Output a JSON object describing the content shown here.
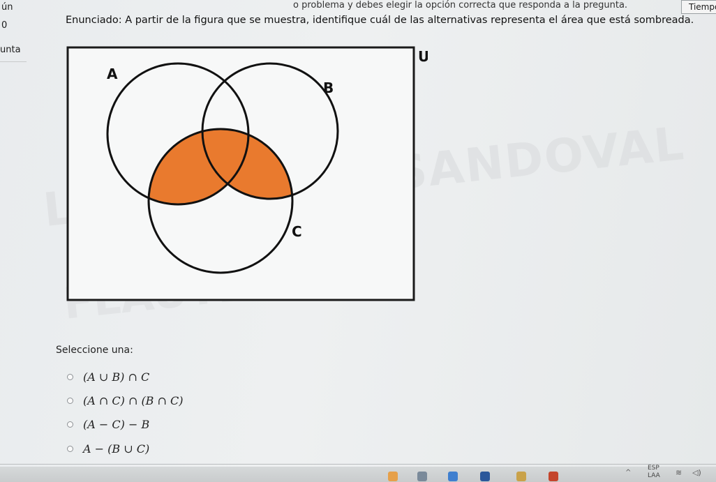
{
  "left_panel": {
    "line1": "ún",
    "line2": "0",
    "line3": "unta"
  },
  "top_instruction": "o problema y debes elegir la opción correcta que responda a la pregunta.",
  "timer_label": "Tiempo",
  "question": "Enunciado: A partir de la figura que se muestra, identifique cuál de las alternativas representa el área que está sombreada.",
  "diagram": {
    "universe_label": "U",
    "set_a_label": "A",
    "set_b_label": "B",
    "set_c_label": "C",
    "shade_color": "#e97a2e"
  },
  "watermark": {
    "line1": "LUZ MIRYAM SANDOVAL",
    "line2": "FLAUTERO"
  },
  "select_label": "Seleccione una:",
  "options": [
    {
      "label": "(A ∪ B) ∩ C"
    },
    {
      "label": "(A ∩ C) ∩ (B ∩ C)"
    },
    {
      "label": "(A − C) − B"
    },
    {
      "label": "A − (B ∪ C)"
    }
  ],
  "taskbar": {
    "language": "ESP",
    "language_sub": "LAA"
  }
}
